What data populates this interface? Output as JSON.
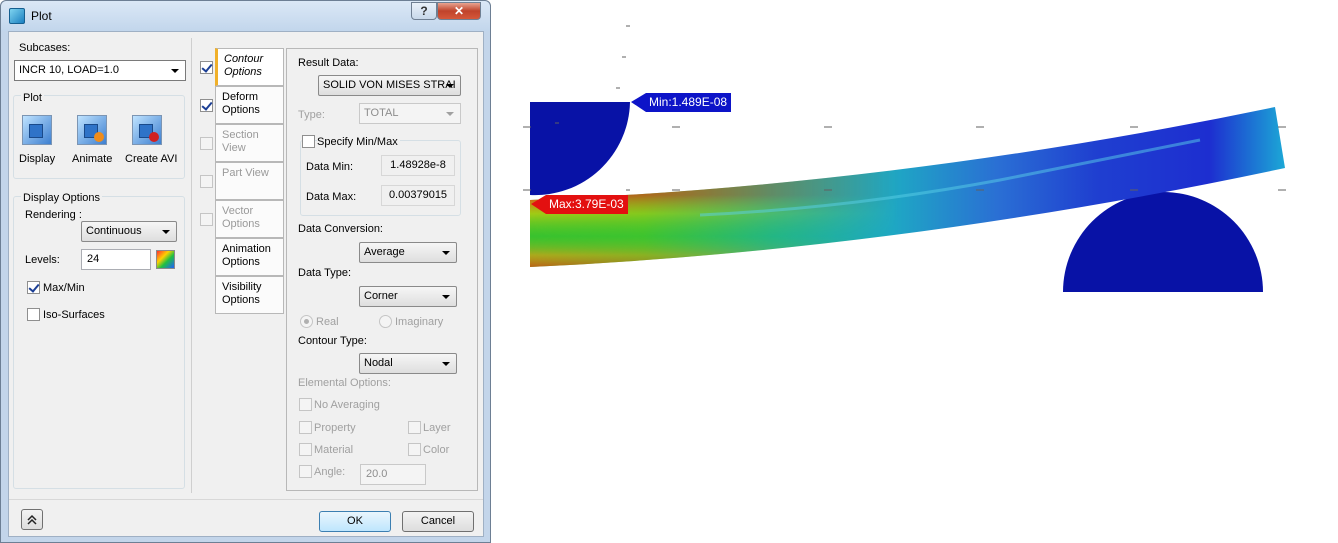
{
  "window": {
    "title": "Plot",
    "help": "?",
    "close": "✕"
  },
  "subcases": {
    "label": "Subcases:",
    "value": "INCR 10, LOAD=1.0"
  },
  "plot_group": {
    "label": "Plot",
    "buttons": [
      {
        "label": "Display",
        "icon": "display-icon"
      },
      {
        "label": "Animate",
        "icon": "animate-icon"
      },
      {
        "label": "Create AVI",
        "icon": "create-avi-icon"
      }
    ]
  },
  "display_options": {
    "label": "Display Options",
    "rendering_label": "Rendering :",
    "rendering_value": "Continuous",
    "levels_label": "Levels:",
    "levels_value": "24",
    "maxmin_label": "Max/Min",
    "maxmin_checked": true,
    "iso_label": "Iso-Surfaces",
    "iso_checked": false
  },
  "tabs": [
    {
      "label": "Contour Options",
      "checked": true,
      "active": true,
      "enabled": true
    },
    {
      "label": "Deform Options",
      "checked": true,
      "active": false,
      "enabled": true
    },
    {
      "label": "Section View",
      "checked": false,
      "active": false,
      "enabled": false
    },
    {
      "label": "Part View",
      "checked": false,
      "active": false,
      "enabled": false
    },
    {
      "label": "Vector Options",
      "checked": false,
      "active": false,
      "enabled": false
    },
    {
      "label": "Animation Options",
      "active": false,
      "enabled": true
    },
    {
      "label": "Visibility Options",
      "active": false,
      "enabled": true
    }
  ],
  "contour": {
    "result_data_label": "Result Data:",
    "result_data_value": "SOLID VON MISES STRAI",
    "type_label": "Type:",
    "type_value": "TOTAL",
    "specify_label": "Specify Min/Max",
    "data_min_label": "Data Min:",
    "data_min_value": "1.48928e-8",
    "data_max_label": "Data Max:",
    "data_max_value": "0.00379015",
    "conversion_label": "Data Conversion:",
    "conversion_value": "Average",
    "data_type_label": "Data Type:",
    "data_type_value": "Corner",
    "real_label": "Real",
    "imaginary_label": "Imaginary",
    "contour_type_label": "Contour Type:",
    "contour_type_value": "Nodal",
    "elemental_label": "Elemental Options:",
    "no_averaging_label": "No Averaging",
    "property_label": "Property",
    "layer_label": "Layer",
    "material_label": "Material",
    "color_label": "Color",
    "angle_label": "Angle:",
    "angle_value": "20.0"
  },
  "footer": {
    "ok": "OK",
    "cancel": "Cancel"
  },
  "viewport": {
    "min_label": "Min:1.489E-08",
    "max_label": "Max:3.79E-03",
    "colors": {
      "min": "#0d14c8",
      "max": "#e31010"
    }
  }
}
